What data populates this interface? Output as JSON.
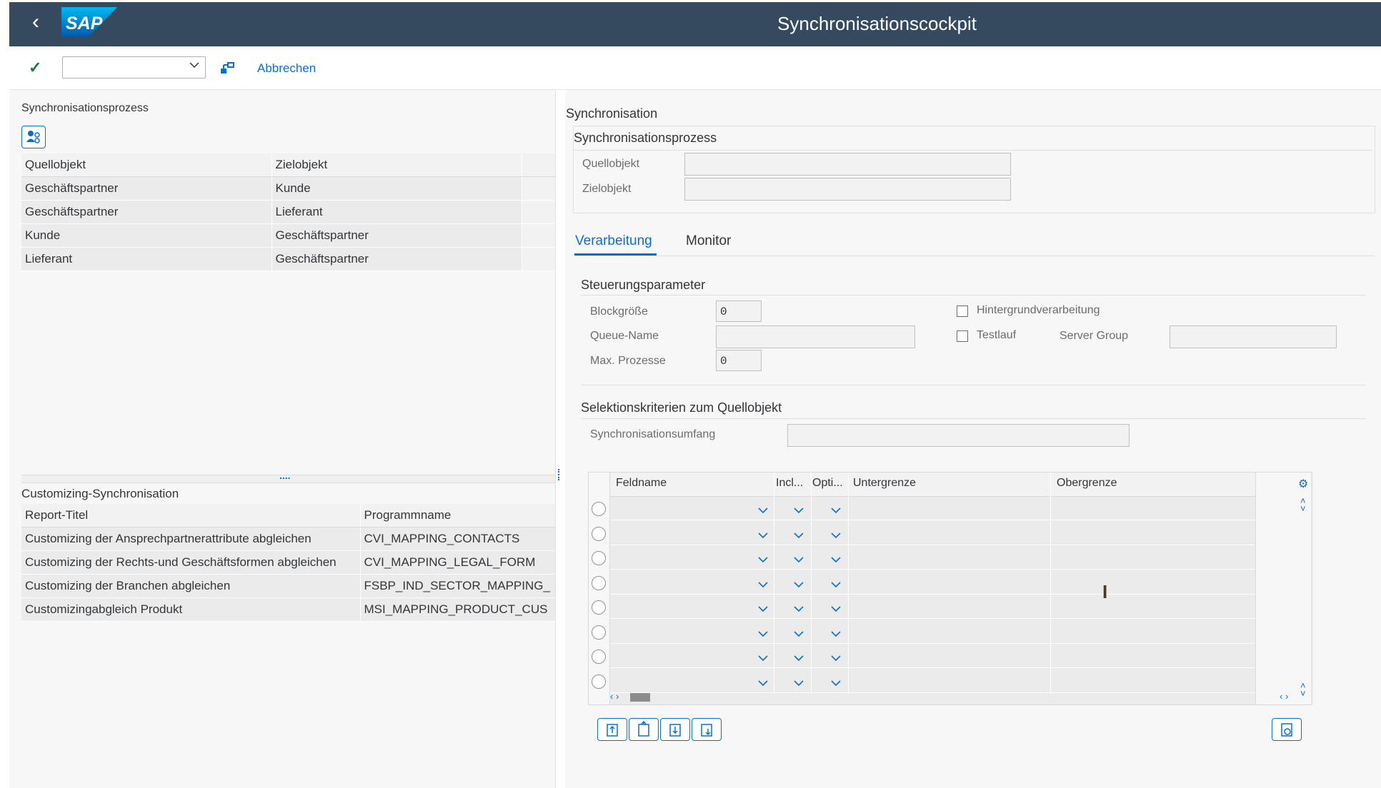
{
  "shell": {
    "title": "Synchronisationscockpit",
    "logo_text": "SAP"
  },
  "toolbar": {
    "cancel_label": "Abbrechen",
    "command_value": ""
  },
  "left": {
    "sync_title": "Synchronisationsprozess",
    "process_table": {
      "headers": [
        "Quellobjekt",
        "Zielobjekt"
      ],
      "rows": [
        [
          "Geschäftspartner",
          "Kunde"
        ],
        [
          "Geschäftspartner",
          "Lieferant"
        ],
        [
          "Kunde",
          "Geschäftspartner"
        ],
        [
          "Lieferant",
          "Geschäftspartner"
        ]
      ]
    },
    "splitter_dots": "....",
    "custom_title": "Customizing-Synchronisation",
    "custom_table": {
      "headers": [
        "Report-Titel",
        "Programmname"
      ],
      "rows": [
        [
          "Customizing der Ansprechpartnerattribute abgleichen",
          "CVI_MAPPING_CONTACTS"
        ],
        [
          "Customizing der Rechts-und Geschäftsformen abgleichen",
          "CVI_MAPPING_LEGAL_FORM"
        ],
        [
          "Customizing der Branchen abgleichen",
          "FSBP_IND_SECTOR_MAPPING_"
        ],
        [
          "Customizingabgleich Produkt",
          "MSI_MAPPING_PRODUCT_CUS"
        ]
      ]
    }
  },
  "right": {
    "section_title": "Synchronisation",
    "group_title": "Synchronisationsprozess",
    "quellobjekt_label": "Quellobjekt",
    "zielobjekt_label": "Zielobjekt",
    "quellobjekt_value": "",
    "zielobjekt_value": "",
    "tabs": [
      {
        "label": "Verarbeitung",
        "active": true
      },
      {
        "label": "Monitor",
        "active": false
      }
    ],
    "params": {
      "title": "Steuerungsparameter",
      "blocksize_label": "Blockgröße",
      "blocksize_value": "0",
      "queue_label": "Queue-Name",
      "queue_value": "",
      "maxproc_label": "Max. Prozesse",
      "maxproc_value": "0",
      "background_label": "Hintergrundverarbeitung",
      "testrun_label": "Testlauf",
      "servergroup_label": "Server Group",
      "servergroup_value": ""
    },
    "selection": {
      "title": "Selektionskriterien zum Quellobjekt",
      "scope_label": "Synchronisationsumfang",
      "scope_value": "",
      "columns": [
        "Feldname",
        "Incl...",
        "Opti...",
        "Untergrenze",
        "Obergrenze"
      ],
      "row_count": 8
    }
  },
  "colors": {
    "shell": "#354a5f",
    "accent": "#0a6ed1",
    "check": "#107e3e"
  }
}
